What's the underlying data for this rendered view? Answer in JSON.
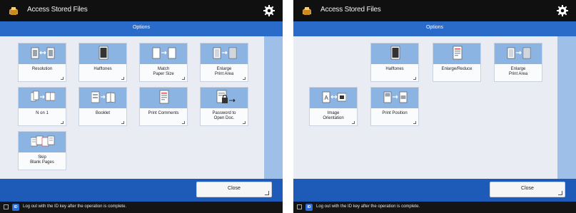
{
  "left_screen": {
    "title": "Access Stored Files",
    "options_title": "Options",
    "tiles": [
      {
        "label": "Resolution"
      },
      {
        "label": "Halftones"
      },
      {
        "label": "Match\nPaper Size"
      },
      {
        "label": "Enlarge\nPrint Area"
      },
      {
        "label": "N on 1"
      },
      {
        "label": "Booklet"
      },
      {
        "label": "Print Comments"
      },
      {
        "label": "Password to\nOpen Doc."
      },
      {
        "label": "Skip\nBlank Pages"
      }
    ],
    "close_label": "Close",
    "status": {
      "id_badge": "ID",
      "message": "Log out with the ID key after the operation is complete."
    }
  },
  "right_screen": {
    "title": "Access Stored Files",
    "options_title": "Options",
    "tiles": [
      {
        "label": "Halftones"
      },
      {
        "label": "Enlarge/Reduce"
      },
      {
        "label": "Enlarge\nPrint Area"
      },
      {
        "label": "Image\nOrientation"
      },
      {
        "label": "Print Position"
      }
    ],
    "close_label": "Close",
    "status": {
      "id_badge": "ID",
      "message": "Log out with the ID key after the operation is complete."
    }
  },
  "colors": {
    "accent": "#2a6ac8",
    "tile_illustration": "#8bb4e2",
    "title_bar": "#101010"
  }
}
